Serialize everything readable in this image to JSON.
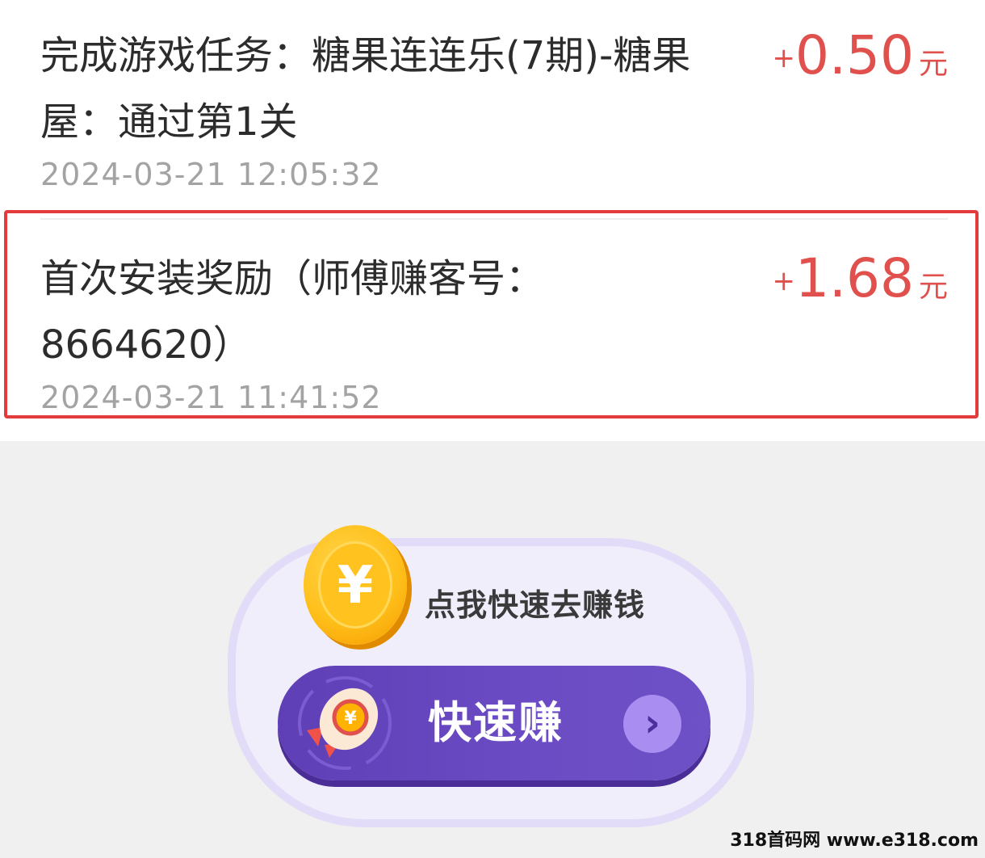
{
  "records": [
    {
      "title": "完成游戏任务：糖果连连乐(7期)-糖果屋：通过第1关",
      "plus": "+",
      "amount": "0.50",
      "unit": "元",
      "time": "2024-03-21 12:05:32"
    },
    {
      "title": "首次安装奖励（师傅赚客号：8664620）",
      "plus": "+",
      "amount": "1.68",
      "unit": "元",
      "time": "2024-03-21 11:41:52"
    }
  ],
  "promo": {
    "coin_symbol": "¥",
    "cta_text": "点我快速去赚钱",
    "button_label": "快速赚",
    "arrow_glyph": "›"
  },
  "watermark": "318首码网 www.e318.com",
  "colors": {
    "amount": "#e0504d",
    "highlight_border": "#e23b3b",
    "button": "#5f3fb6"
  }
}
